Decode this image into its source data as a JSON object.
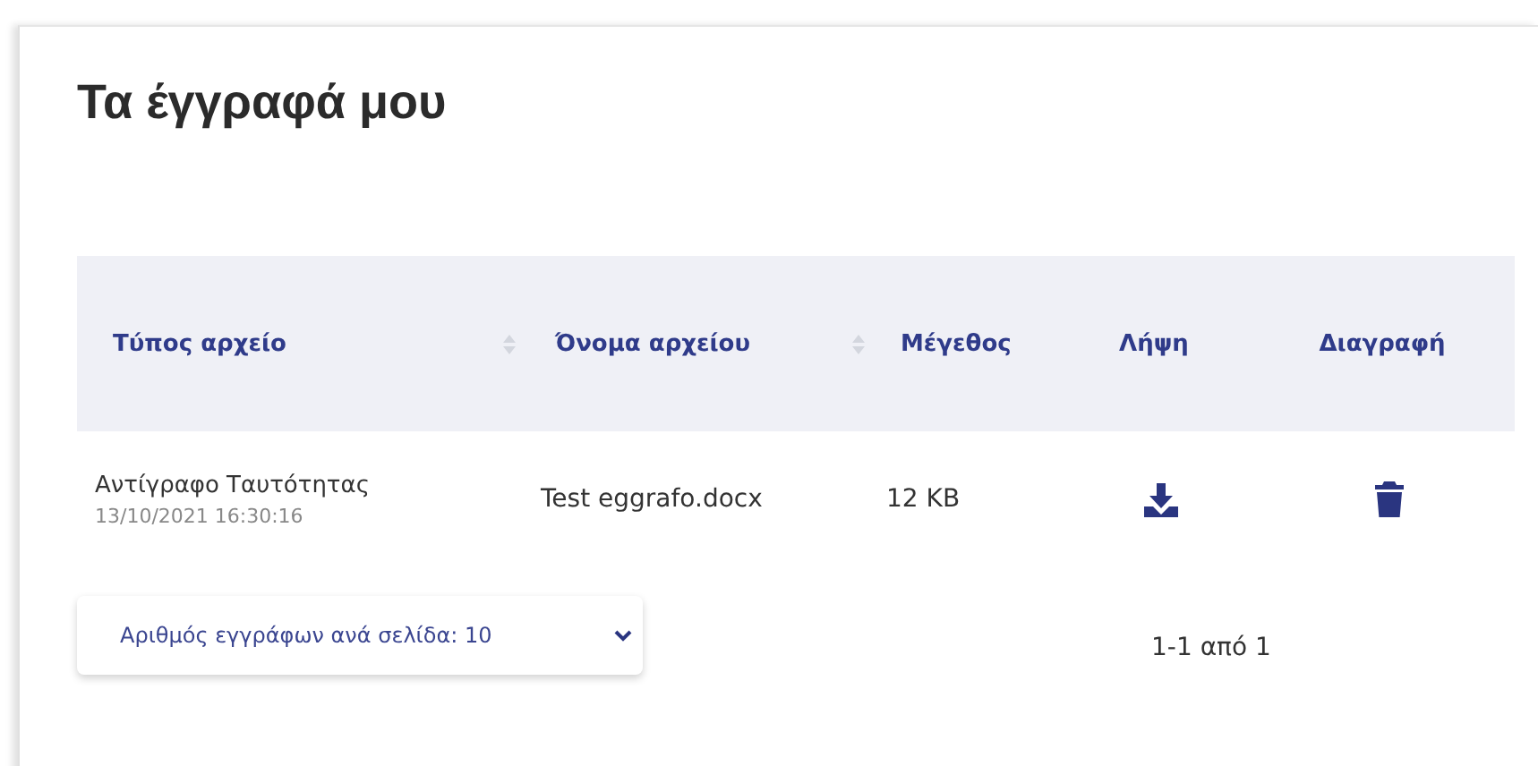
{
  "page": {
    "title": "Τα έγγραφά μου"
  },
  "table": {
    "columns": [
      {
        "label": "Τύπος αρχείο",
        "sortable": true
      },
      {
        "label": "Όνομα αρχείου",
        "sortable": true
      },
      {
        "label": "Μέγεθος",
        "sortable": false
      },
      {
        "label": "Λήψη",
        "sortable": false
      },
      {
        "label": "Διαγραφή",
        "sortable": false
      }
    ],
    "rows": [
      {
        "type": "Αντίγραφο Ταυτότητας",
        "date": "13/10/2021 16:30:16",
        "name": "Test eggrafo.docx",
        "size": "12 KB"
      }
    ]
  },
  "pagination": {
    "page_size": "Αριθμός εγγράφων ανά σελίδα: 10",
    "range": "1-1 από 1"
  }
}
